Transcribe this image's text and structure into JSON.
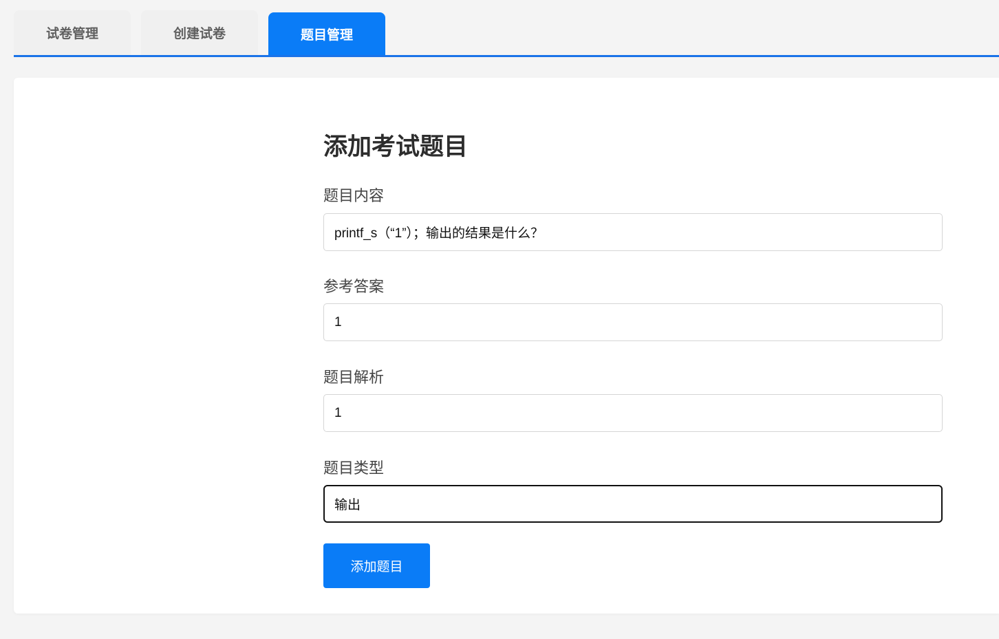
{
  "tabs": [
    {
      "label": "试卷管理",
      "active": false
    },
    {
      "label": "创建试卷",
      "active": false
    },
    {
      "label": "题目管理",
      "active": true
    }
  ],
  "form": {
    "title": "添加考试题目",
    "fields": {
      "content": {
        "label": "题目内容",
        "value": "printf_s（“1”）；输出的结果是什么？"
      },
      "answer": {
        "label": "参考答案",
        "value": "1"
      },
      "analysis": {
        "label": "题目解析",
        "value": "1"
      },
      "type": {
        "label": "题目类型",
        "value": "输出"
      }
    },
    "submit_label": "添加题目"
  },
  "colors": {
    "accent": "#0a7cf7",
    "tab_underline": "#1a73e8",
    "page_background": "#f4f4f4",
    "card_background": "#ffffff"
  }
}
